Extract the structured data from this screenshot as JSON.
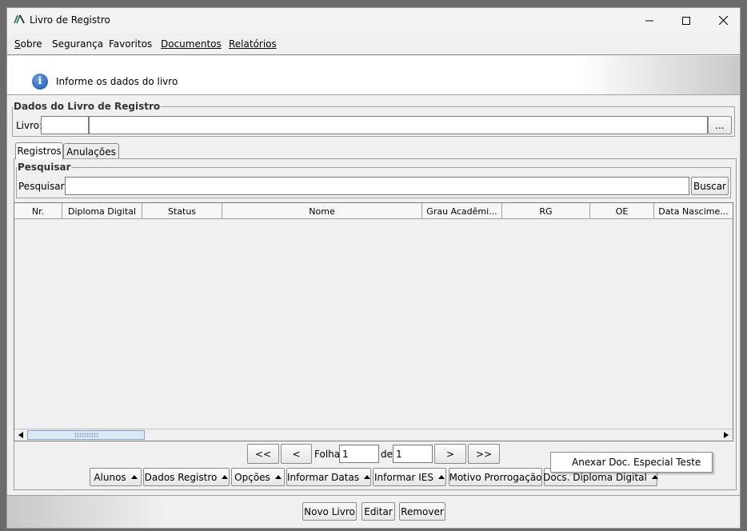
{
  "window": {
    "title": "Livro de Registro",
    "minimize_icon": "minimize-icon",
    "maximize_icon": "maximize-icon",
    "close_icon": "close-icon"
  },
  "menubar": {
    "items": [
      {
        "label": "Sobre",
        "mnemonic": "S"
      },
      {
        "label": "Segurança",
        "mnemonic": ""
      },
      {
        "label": "Favoritos",
        "mnemonic": ""
      },
      {
        "label": "Documentos",
        "mnemonic": "D"
      },
      {
        "label": "Relatórios",
        "mnemonic": "R"
      }
    ]
  },
  "banner": {
    "icon": "info-icon",
    "message": "Informe os dados do livro"
  },
  "livro_group": {
    "legend": "Dados do Livro de Registro",
    "livro_label": "Livro:",
    "code_value": "",
    "name_value": "",
    "browse_label": "..."
  },
  "tabs": [
    {
      "label": "Registros",
      "active": true
    },
    {
      "label": "Anulações",
      "active": false
    }
  ],
  "search": {
    "legend": "Pesquisar",
    "label": "Pesquisar:",
    "value": "",
    "button_label": "Buscar"
  },
  "table": {
    "columns": [
      "Nr.",
      "Diploma Digital",
      "Status",
      "Nome",
      "Grau Acadêmi...",
      "RG",
      "OE",
      "Data Nascime..."
    ],
    "rows": []
  },
  "pagination": {
    "first_label": "<<",
    "prev_label": "<",
    "folha_label": "Folha",
    "folha_value": "1",
    "de_label": "de",
    "de_value": "1",
    "next_label": ">",
    "last_label": ">>"
  },
  "popup_menu": {
    "item": "Anexar Doc. Especial Teste"
  },
  "action_buttons": [
    {
      "label": "Alunos"
    },
    {
      "label": "Dados Registro"
    },
    {
      "label": "Opções"
    },
    {
      "label": "Informar Datas"
    },
    {
      "label": "Informar IES"
    },
    {
      "label": "Motivo Prorrogação"
    },
    {
      "label": "Docs. Diploma Digital"
    }
  ],
  "footer_buttons": {
    "new_label": "Novo Livro",
    "edit_label": "Editar",
    "remove_label": "Remover"
  },
  "colors": {
    "window_bg": "#f0f0f0",
    "info_blue": "#1b4fa8",
    "scroll_thumb": "#dce8f6",
    "app_icon_green": "#2e8b57"
  }
}
